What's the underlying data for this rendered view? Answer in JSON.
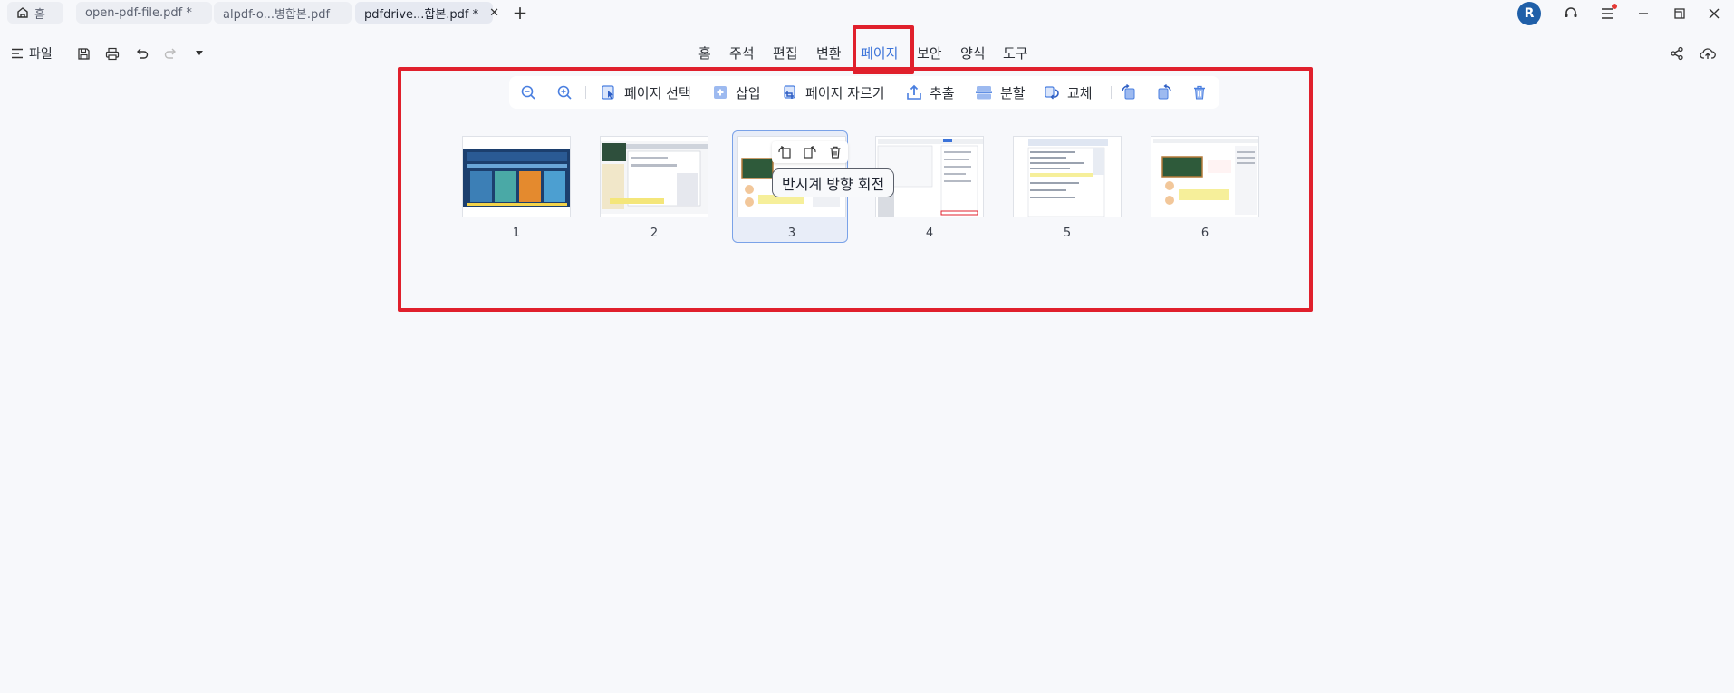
{
  "tabs": {
    "home": "홈",
    "tab1": "open-pdf-file.pdf *",
    "tab2": "alpdf-o...병합본.pdf",
    "tab3": "pdfdrive...합본.pdf *",
    "close": "✕",
    "add": "+"
  },
  "user": {
    "avatar_initial": "R"
  },
  "toolbar": {
    "file_label": "파일"
  },
  "menu": {
    "items": [
      "홈",
      "주석",
      "편집",
      "변환",
      "페이지",
      "보안",
      "양식",
      "도구"
    ],
    "active": "페이지"
  },
  "ribbon": {
    "select_pages": "페이지 선택",
    "insert": "삽입",
    "crop_pages": "페이지 자르기",
    "extract": "추출",
    "split": "분할",
    "replace": "교체"
  },
  "thumbnails": {
    "pages": [
      "1",
      "2",
      "3",
      "4",
      "5",
      "6"
    ],
    "selected": "3"
  },
  "tooltip": {
    "text": "반시계 방향 회전"
  },
  "colors": {
    "accent": "#3b73d9",
    "highlight_red": "#e0202c",
    "avatar": "#1f5fa8"
  }
}
